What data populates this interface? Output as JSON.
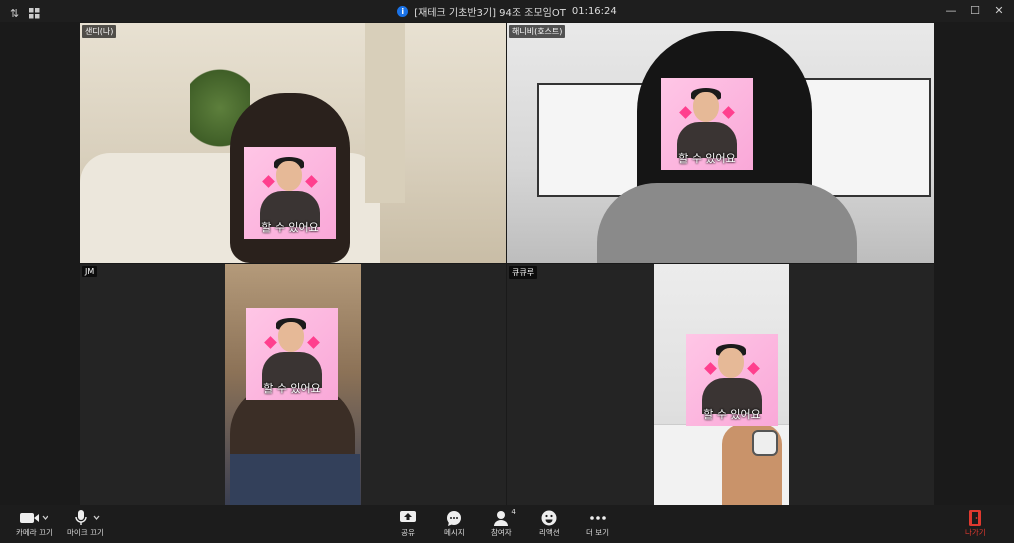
{
  "window": {
    "title": "[재테크 기초반3기] 94조 조모임OT",
    "timer": "01:16:24"
  },
  "participants": [
    {
      "name": "샌디(나)",
      "sticker_text": "할 수 있어요"
    },
    {
      "name": "해니비(호스트)",
      "sticker_text": "할 수 있어요"
    },
    {
      "name": "JM",
      "sticker_text": "할 수 있어요"
    },
    {
      "name": "큐큐루",
      "sticker_text": "할 수 있어요"
    }
  ],
  "toolbar": {
    "camera_label": "카메라 끄기",
    "mic_label": "마이크 끄기",
    "share_label": "공유",
    "message_label": "메시지",
    "participants_label": "참여자",
    "participants_count": "4",
    "reaction_label": "리액션",
    "more_label": "더 보기",
    "leave_label": "나가기"
  },
  "colors": {
    "leave": "#e0392f",
    "info": "#1a73e8",
    "sticker_pink": "#f9a8d8"
  }
}
